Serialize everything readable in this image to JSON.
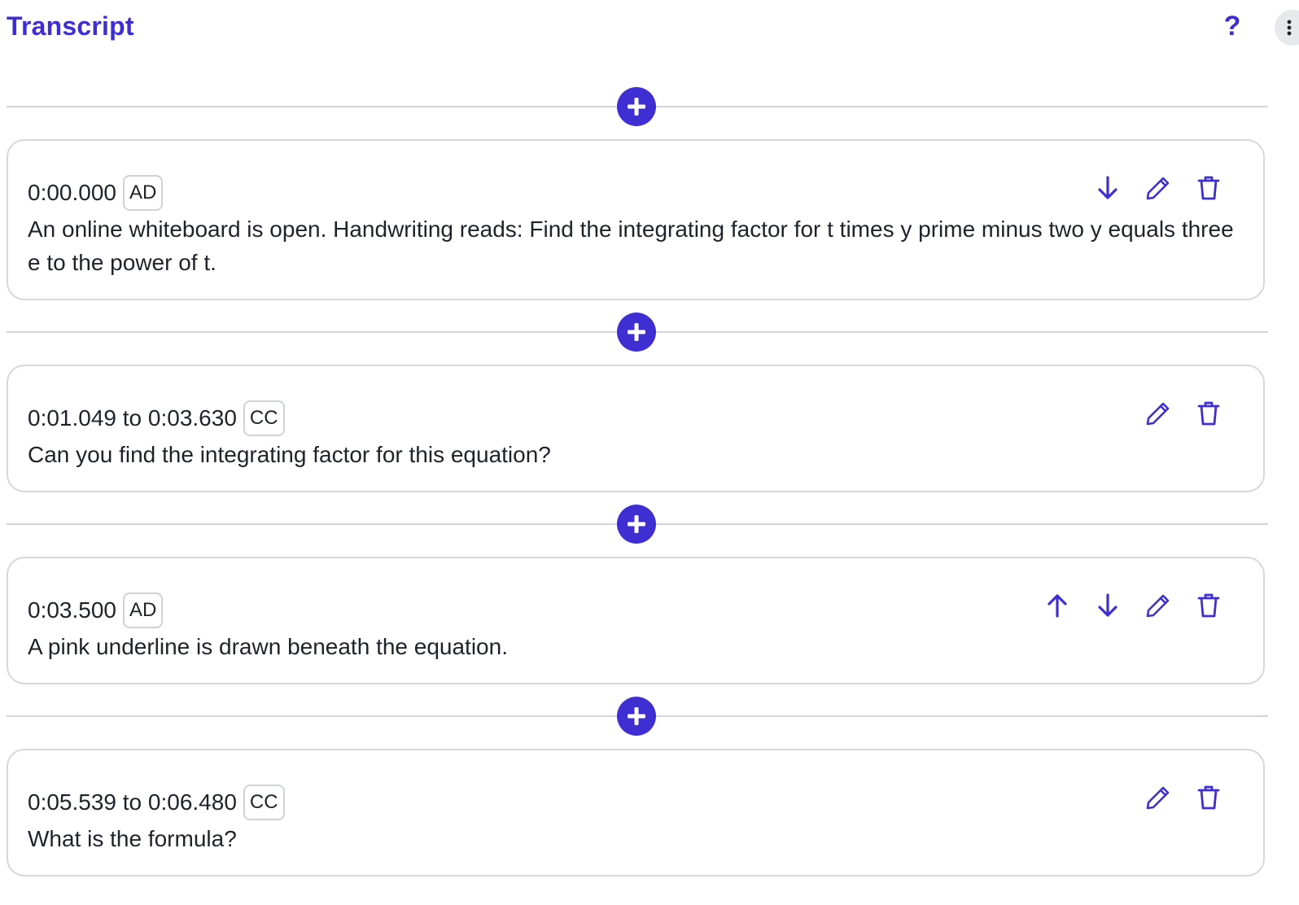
{
  "header": {
    "title": "Transcript",
    "help_label": "?"
  },
  "colors": {
    "accent": "#3f2fd3",
    "border": "#d6d8dc",
    "text": "#1f2329"
  },
  "icons": {
    "insert": "plus-circle-icon",
    "move_up": "arrow-up-icon",
    "move_down": "arrow-down-icon",
    "edit": "pencil-icon",
    "delete": "trash-icon",
    "menu": "more-vertical-icon"
  },
  "entries": [
    {
      "time": "0:00.000",
      "type": "AD",
      "text": "An online whiteboard is open. Handwriting reads: Find the integrating factor for t times y prime minus two y equals three e to the power of t.",
      "actions": [
        "move_down",
        "edit",
        "delete"
      ]
    },
    {
      "time": "0:01.049 to 0:03.630",
      "type": "CC",
      "text": "Can you find the integrating factor for this equation?",
      "actions": [
        "edit",
        "delete"
      ]
    },
    {
      "time": "0:03.500",
      "type": "AD",
      "text": "A pink underline is drawn beneath the equation.",
      "actions": [
        "move_up",
        "move_down",
        "edit",
        "delete"
      ]
    },
    {
      "time": "0:05.539 to 0:06.480",
      "type": "CC",
      "text": "What is the formula?",
      "actions": [
        "edit",
        "delete"
      ]
    }
  ]
}
